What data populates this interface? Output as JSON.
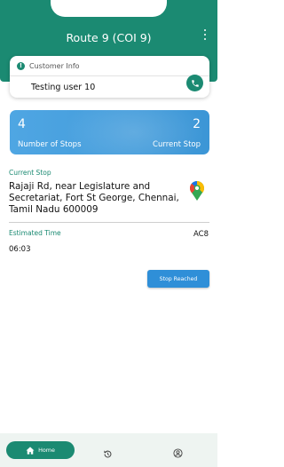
{
  "header": {
    "title": "Route 9 (COI 9)"
  },
  "customer_info": {
    "label": "Customer Info",
    "name": "Testing user 10"
  },
  "stats": {
    "stops_value": "4",
    "stops_label": "Number of Stops",
    "current_value": "2",
    "current_label": "Current Stop"
  },
  "current_stop": {
    "label": "Current Stop",
    "address": "Rajaji Rd, near Legislature and Secretariat, Fort St George, Chennai, Tamil Nadu 600009"
  },
  "estimated": {
    "label": "Estimated Time",
    "code": "AC8",
    "time": "06:03"
  },
  "actions": {
    "stop_reached": "Stop Reached"
  },
  "nav": {
    "home_label": "Home"
  },
  "colors": {
    "primary": "#1b8a72",
    "card_blue": "#4fa6e3",
    "button_blue": "#2f8fd8"
  },
  "icons": [
    "more-vert-icon",
    "alert-info-icon",
    "phone-icon",
    "google-maps-icon",
    "home-icon",
    "history-icon",
    "profile-icon"
  ]
}
